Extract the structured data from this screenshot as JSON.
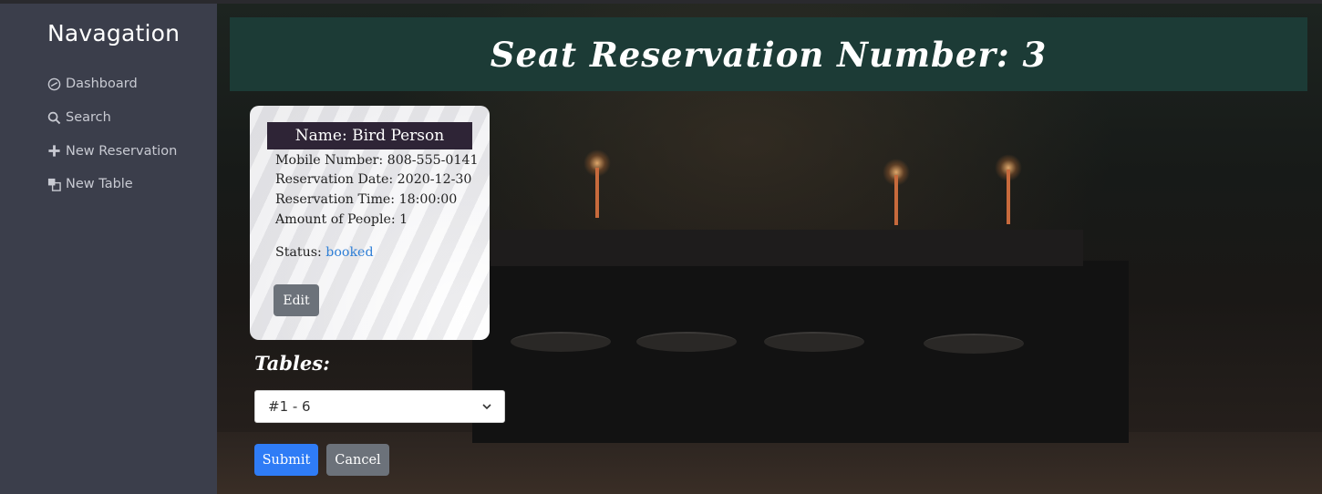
{
  "sidebar": {
    "title": "Navagation",
    "items": [
      {
        "label": "Dashboard",
        "icon": "dashboard-icon"
      },
      {
        "label": "Search",
        "icon": "search-icon"
      },
      {
        "label": "New Reservation",
        "icon": "plus-icon"
      },
      {
        "label": "New Table",
        "icon": "table-icon"
      }
    ]
  },
  "header": {
    "title": "Seat Reservation Number: 3"
  },
  "reservation": {
    "name": "Name: Bird Person",
    "mobile": "Mobile Number: 808-555-0141",
    "date": "Reservation Date: 2020-12-30",
    "time": "Reservation Time: 18:00:00",
    "people": "Amount of People: 1",
    "status_label": "Status: ",
    "status_value": "booked",
    "edit_label": "Edit"
  },
  "form": {
    "tables_label": "Tables:",
    "selected_table": "#1 - 6",
    "submit_label": "Submit",
    "cancel_label": "Cancel"
  },
  "colors": {
    "sidebar_bg": "#3b3e4b",
    "header_bg": "#1c3b36",
    "name_bar_bg": "#2e2436",
    "status_link": "#2f7fd6",
    "submit_bg": "#2f7cf6",
    "secondary_btn": "#6c727a"
  }
}
